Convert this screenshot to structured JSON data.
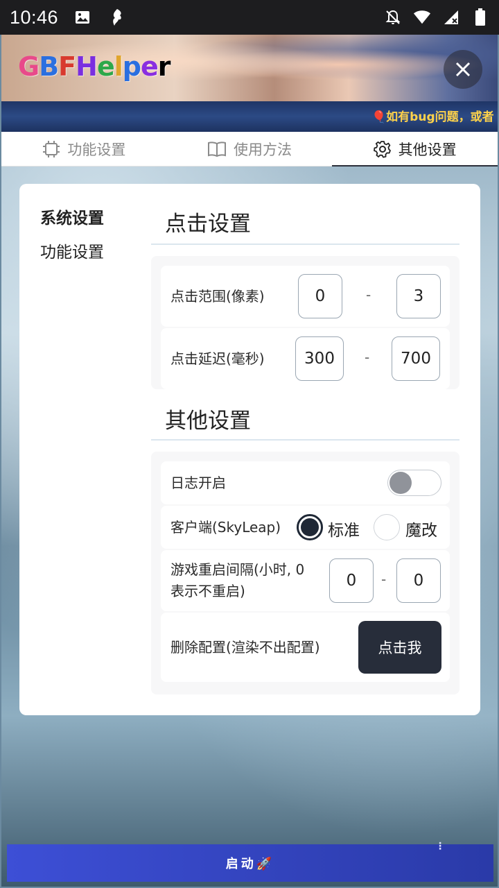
{
  "status_bar": {
    "time": "10:46"
  },
  "header": {
    "logo_letters": [
      "G",
      "B",
      "F",
      "H",
      "e",
      "l",
      "p",
      "e",
      "r"
    ],
    "marquee": "🎈如有bug问题，或者"
  },
  "tabs": [
    {
      "label": "功能设置",
      "icon": "chip-icon",
      "active": false
    },
    {
      "label": "使用方法",
      "icon": "book-icon",
      "active": false
    },
    {
      "label": "其他设置",
      "icon": "gear-icon",
      "active": true
    }
  ],
  "side_nav": [
    {
      "label": "系统设置",
      "active": true
    },
    {
      "label": "功能设置",
      "active": false
    }
  ],
  "click_settings": {
    "title": "点击设置",
    "range": {
      "label": "点击范围(像素)",
      "min": "0",
      "sep": "-",
      "max": "3"
    },
    "delay": {
      "label": "点击延迟(毫秒)",
      "min": "300",
      "sep": "-",
      "max": "700"
    }
  },
  "other_settings": {
    "title": "其他设置",
    "log": {
      "label": "日志开启",
      "enabled": false
    },
    "client": {
      "label": "客户端(SkyLeap)",
      "option_standard": "标准",
      "option_modified": "魔改",
      "selected": "标准"
    },
    "restart": {
      "label_line1": "游戏重启间隔(小时, 0",
      "label_line2": "表示不重启)",
      "min": "0",
      "sep": "-",
      "max": "0"
    },
    "delete_config": {
      "label": "删除配置(渲染不出配置)",
      "button": "点击我"
    }
  },
  "start_button": {
    "label": "启动🚀"
  },
  "colors": {
    "accent_dark": "#272d3a",
    "start_gradient_from": "#3d4fd6",
    "start_gradient_to": "#2a3aa8",
    "marquee_text": "#ffd24a"
  }
}
